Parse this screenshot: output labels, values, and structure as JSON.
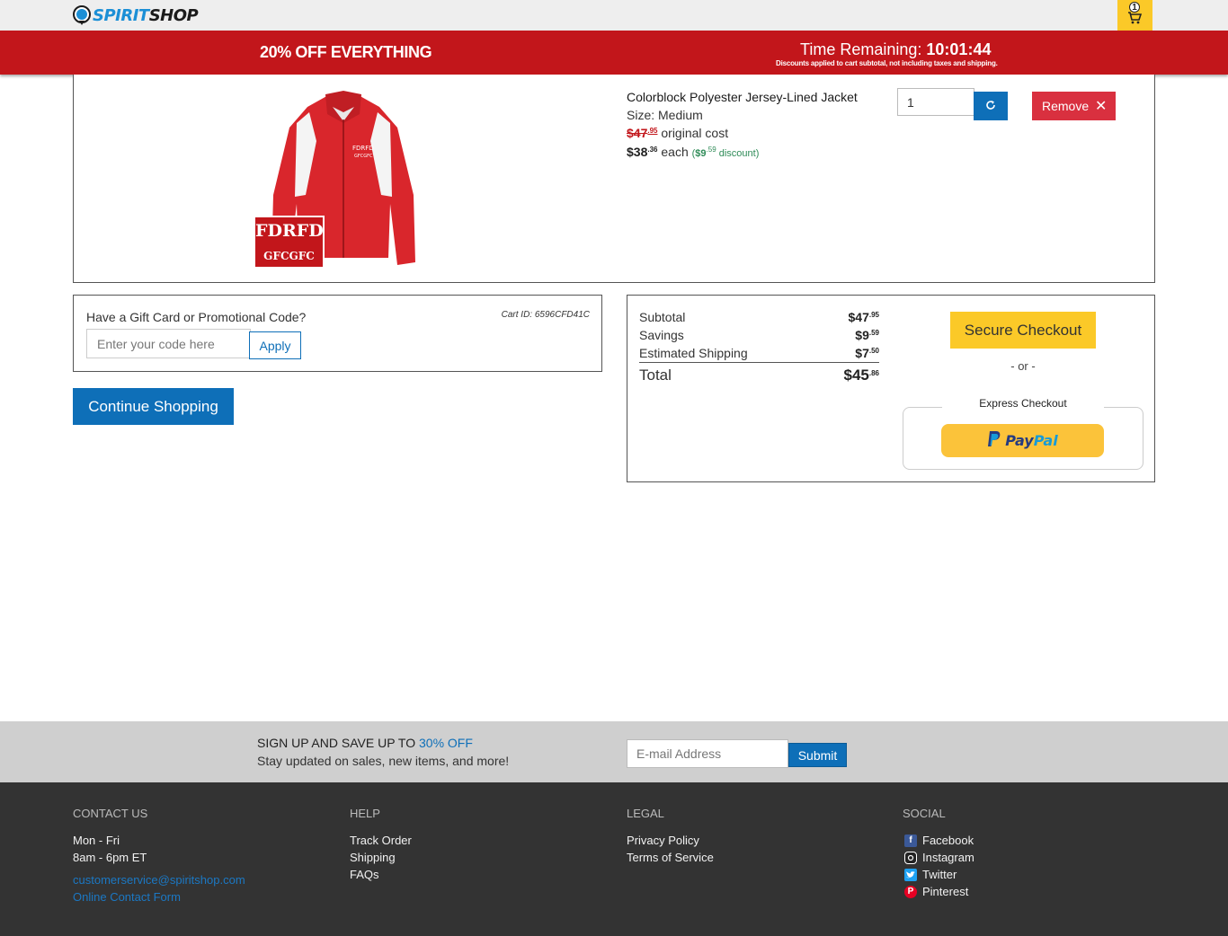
{
  "header": {
    "logo_part1": "SPIRIT",
    "logo_part2": "SHOP",
    "cart_count": "1"
  },
  "banner": {
    "promo": "20% OFF EVERYTHING",
    "timer_label": "Time Remaining:",
    "timer_value": "10:01:44",
    "note": "Discounts applied to cart subtotal, not including taxes and shipping."
  },
  "item": {
    "name": "Colorblock Polyester Jersey-Lined Jacket",
    "size": "Size: Medium",
    "original_dollars": "$47",
    "original_cents": ".95",
    "original_label": " original cost",
    "each_dollars": "$38",
    "each_cents": ".36",
    "each_label": " each ",
    "discount_open": "(",
    "discount_dollars": "$9",
    "discount_cents": ".59",
    "discount_label": " discount)",
    "patch_line1": "FDRFD",
    "patch_line2": "GFCGFC",
    "quantity": "1",
    "remove_label": "Remove",
    "colors": {
      "jacket_red": "#d9262c",
      "jacket_white": "#f4f4f4"
    }
  },
  "promo": {
    "label": "Have a Gift Card or Promotional Code?",
    "cart_id": "Cart ID: 6596CFD41C",
    "placeholder": "Enter your code here",
    "apply_label": "Apply"
  },
  "continue_label": "Continue Shopping",
  "summary": {
    "subtotal_label": "Subtotal",
    "subtotal_dollars": "$47",
    "subtotal_cents": ".95",
    "savings_label": "Savings",
    "savings_dollars": "$9",
    "savings_cents": ".59",
    "shipping_label": "Estimated Shipping",
    "shipping_dollars": "$7",
    "shipping_cents": ".50",
    "total_label": "Total",
    "total_dollars": "$45",
    "total_cents": ".86",
    "checkout_label": "Secure Checkout",
    "or_label": "- or -",
    "express_label": "Express Checkout",
    "paypal_part1": "Pay",
    "paypal_part2": "Pal"
  },
  "newsletter": {
    "title_prefix": "SIGN UP AND SAVE UP TO ",
    "title_highlight": "30% OFF",
    "subtitle": "Stay updated on sales, new items, and more!",
    "placeholder": "E-mail Address",
    "submit_label": "Submit"
  },
  "footer": {
    "contact": {
      "heading": "CONTACT US",
      "days": "Mon - Fri",
      "hours": "8am - 6pm ET",
      "email": "customerservice@spiritshop.com",
      "form": "Online Contact Form"
    },
    "help": {
      "heading": "HELP",
      "items": [
        "Track Order",
        "Shipping",
        "FAQs"
      ]
    },
    "legal": {
      "heading": "LEGAL",
      "items": [
        "Privacy Policy",
        "Terms of Service"
      ]
    },
    "social": {
      "heading": "SOCIAL",
      "items": [
        {
          "label": "Facebook",
          "icon": "facebook-icon",
          "color": "#3b5998"
        },
        {
          "label": "Instagram",
          "icon": "instagram-icon",
          "color": "#222222"
        },
        {
          "label": "Twitter",
          "icon": "twitter-icon",
          "color": "#1da1f2"
        },
        {
          "label": "Pinterest",
          "icon": "pinterest-icon",
          "color": "#e60023"
        }
      ]
    }
  },
  "colors": {
    "banner_red": "#c2161b",
    "accent_blue": "#0e6fb8",
    "checkout_yellow": "#fbc928",
    "remove_red": "#d9303f",
    "footer_bg": "#333333"
  }
}
